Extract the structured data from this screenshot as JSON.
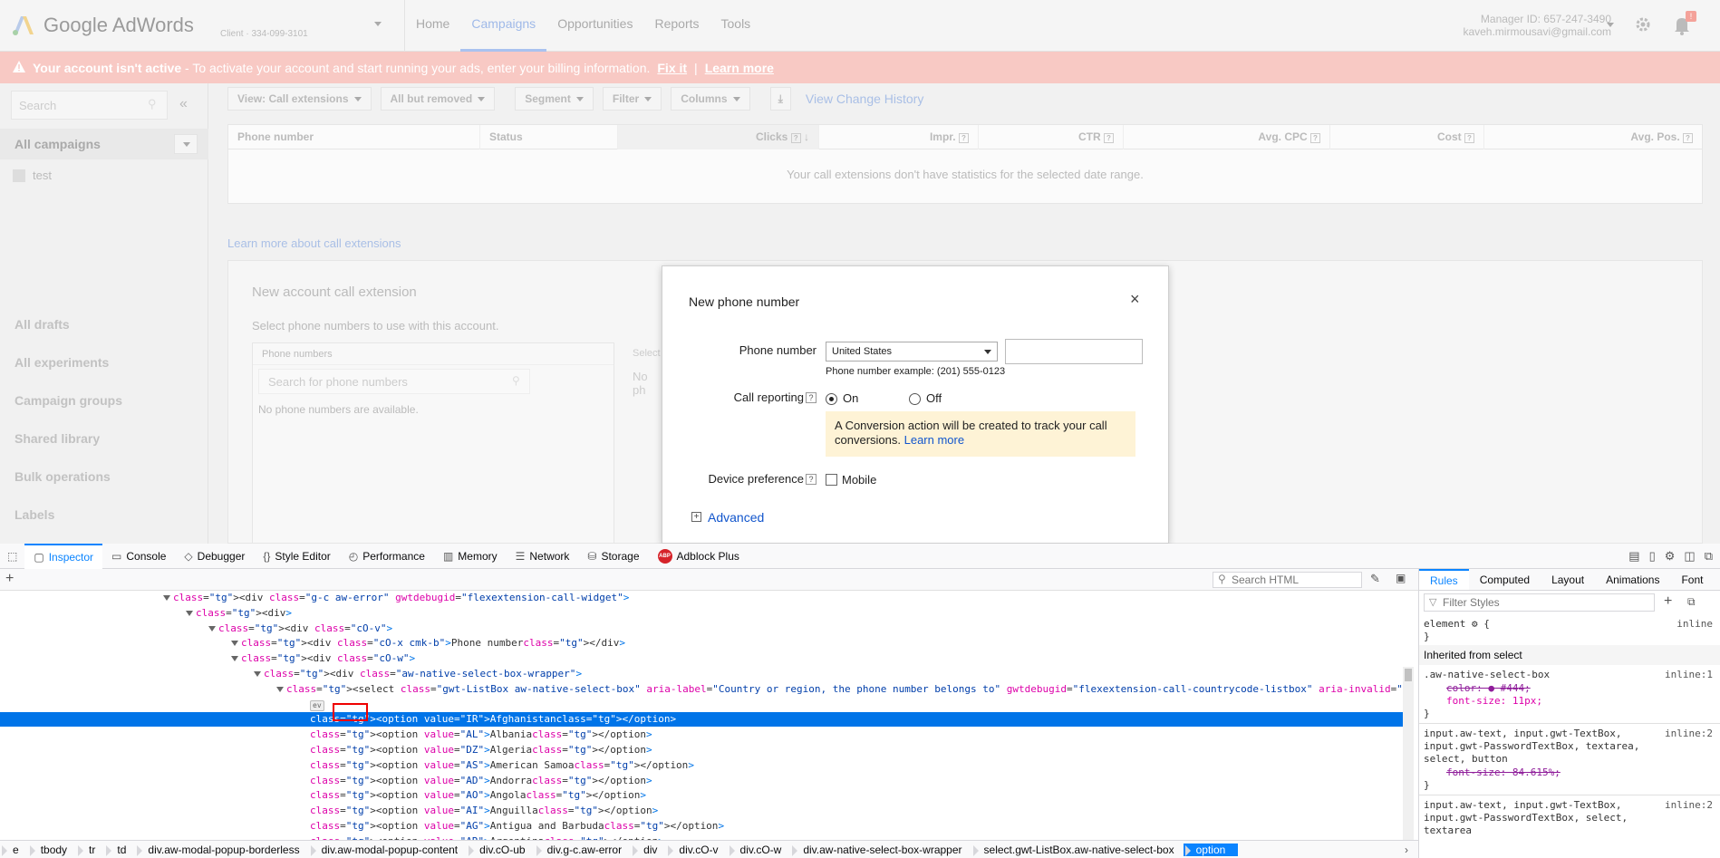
{
  "app": {
    "logo_text": "Google AdWords",
    "account_name_line": "Client · 334-099-3101",
    "account_label": "Client",
    "nav": [
      "Home",
      "Campaigns",
      "Opportunities",
      "Reports",
      "Tools"
    ],
    "active_nav": "Campaigns",
    "manager_id": "Manager ID: 657-247-3490",
    "email": "kaveh.mirmousavi@gmail.com",
    "notification_count": "!"
  },
  "banner": {
    "bold": "Your account isn't active",
    "text": " - To activate your account and start running your ads, enter your billing information.",
    "fix": "Fix it",
    "sep": "|",
    "learn": "Learn more"
  },
  "sidebar": {
    "search_placeholder": "Search",
    "collapse": "«",
    "all_campaigns": "All campaigns",
    "campaign": "test",
    "links": [
      "All drafts",
      "All experiments",
      "Campaign groups",
      "Shared library",
      "Bulk operations",
      "Labels"
    ]
  },
  "toolbar": {
    "view": "View: Call extensions",
    "filter_removed": "All but removed",
    "segment": "Segment",
    "filter": "Filter",
    "columns": "Columns",
    "view_history": "View Change History"
  },
  "table": {
    "headers": [
      "Phone number",
      "Status",
      "Clicks",
      "Impr.",
      "CTR",
      "Avg. CPC",
      "Cost",
      "Avg. Pos."
    ],
    "empty": "Your call extensions don't have statistics for the selected date range."
  },
  "learn_call_ext": "Learn more about call extensions",
  "new_account": {
    "title": "New account call extension",
    "subtitle": "Select phone numbers to use with this account.",
    "phone_numbers_header": "Phone numbers",
    "search_placeholder": "Search for phone numbers",
    "none": "No phone numbers are available.",
    "selected_header": "Select",
    "selected_none": "No ph"
  },
  "dialog": {
    "title": "New phone number",
    "close": "×",
    "phone_label": "Phone number",
    "country": "United States",
    "example": "Phone number example: (201) 555-0123",
    "call_reporting_label": "Call reporting",
    "q": "?",
    "on": "On",
    "off": "Off",
    "note": "A Conversion action will be created to track your call conversions.",
    "note_link": "Learn more",
    "device_label": "Device preference",
    "mobile": "Mobile",
    "advanced": "Advanced"
  },
  "devtools": {
    "tabs": [
      {
        "label": "Inspector",
        "icon": "inspector-icon",
        "glyph": "▢"
      },
      {
        "label": "Console",
        "icon": "console-icon",
        "glyph": "▭"
      },
      {
        "label": "Debugger",
        "icon": "debugger-icon",
        "glyph": "◇"
      },
      {
        "label": "Style Editor",
        "icon": "style-editor-icon",
        "glyph": "{}"
      },
      {
        "label": "Performance",
        "icon": "performance-icon",
        "glyph": "◴"
      },
      {
        "label": "Memory",
        "icon": "memory-icon",
        "glyph": "▥"
      },
      {
        "label": "Network",
        "icon": "network-icon",
        "glyph": "☰"
      },
      {
        "label": "Storage",
        "icon": "storage-icon",
        "glyph": "⛁"
      },
      {
        "label": "Adblock Plus",
        "icon": "adblock-icon",
        "glyph": "ABP"
      }
    ],
    "search_html": "Search HTML",
    "html_lines": [
      {
        "indent": 0,
        "text": "<div class=\"g-c aw-error\" gwtdebugid=\"flexextension-call-widget\">"
      },
      {
        "indent": 1,
        "text": "<div>"
      },
      {
        "indent": 2,
        "text": "<div class=\"cO-v\">"
      },
      {
        "indent": 3,
        "text": "<div class=\"cO-x cmk-b\">Phone number</div>"
      },
      {
        "indent": 3,
        "text": "<div class=\"cO-w\">"
      },
      {
        "indent": 4,
        "text": "<div class=\"aw-native-select-box-wrapper\">"
      },
      {
        "indent": 5,
        "text": "<select class=\"gwt-ListBox aw-native-select-box\" aria-label=\"Country or region, the phone number belongs to\" gwtdebugid=\"flexextension-call-countrycode-listbox\" aria-invalid=\"false\">"
      },
      {
        "indent": 6,
        "text": "ev"
      },
      {
        "indent": 6,
        "text": "<option value=\"IR\">Afghanistan</option>"
      },
      {
        "indent": 6,
        "text": "<option value=\"AL\">Albania</option>"
      },
      {
        "indent": 6,
        "text": "<option value=\"DZ\">Algeria</option>"
      },
      {
        "indent": 6,
        "text": "<option value=\"AS\">American Samoa</option>"
      },
      {
        "indent": 6,
        "text": "<option value=\"AD\">Andorra</option>"
      },
      {
        "indent": 6,
        "text": "<option value=\"AO\">Angola</option>"
      },
      {
        "indent": 6,
        "text": "<option value=\"AI\">Anguilla</option>"
      },
      {
        "indent": 6,
        "text": "<option value=\"AG\">Antigua and Barbuda</option>"
      },
      {
        "indent": 6,
        "text": "<option value=\"AR\">Argentina</option>"
      }
    ],
    "rules_tabs": [
      "Rules",
      "Computed",
      "Layout",
      "Animations",
      "Font"
    ],
    "filter_placeholder": "Filter Styles",
    "rules": {
      "element": "element",
      "brace_open": "{",
      "brace_close": "}",
      "inline": "inline",
      "inherited": "Inherited from select",
      "rule1_selector": ".aw-native-select-box",
      "rule1_src": "inline:1",
      "rule1_color": "color: ● #444;",
      "rule1_font": "font-size: 11px;",
      "rule2_selector": "input.aw-text, input.gwt-TextBox,",
      "rule2_selector2": "input.gwt-PasswordTextBox, textarea,",
      "rule2_selector3": "select, button",
      "rule2_src": "inline:2",
      "rule2_font": "font-size: 84.615%;",
      "rule3_selector": "input.aw-text, input.gwt-TextBox,",
      "rule3_selector2": "input.gwt-PasswordTextBox, select,",
      "rule3_selector3": "textarea",
      "rule3_src": "inline:2"
    },
    "breadcrumbs": [
      "e",
      "tbody",
      "tr",
      "td",
      "div.aw-modal-popup-borderless",
      "div.aw-modal-popup-content",
      "div.cO-ub",
      "div.g-c.aw-error",
      "div",
      "div.cO-v",
      "div.cO-w",
      "div.aw-native-select-box-wrapper",
      "select.gwt-ListBox.aw-native-select-box",
      "option"
    ]
  }
}
